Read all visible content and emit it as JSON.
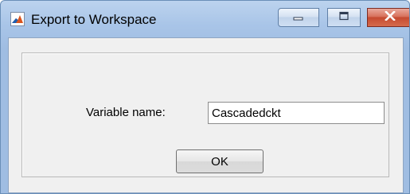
{
  "window": {
    "title": "Export to Workspace",
    "icons": {
      "app": "matlab-logo-icon",
      "minimize": "minimize-icon",
      "maximize": "maximize-icon",
      "close": "close-icon"
    }
  },
  "form": {
    "variable_label": "Variable name:",
    "variable_value": "Cascadedckt",
    "ok_label": "OK"
  },
  "colors": {
    "title_bar": "#a9c5e8",
    "close_button": "#c54a30",
    "content_bg": "#f0f0f0"
  }
}
